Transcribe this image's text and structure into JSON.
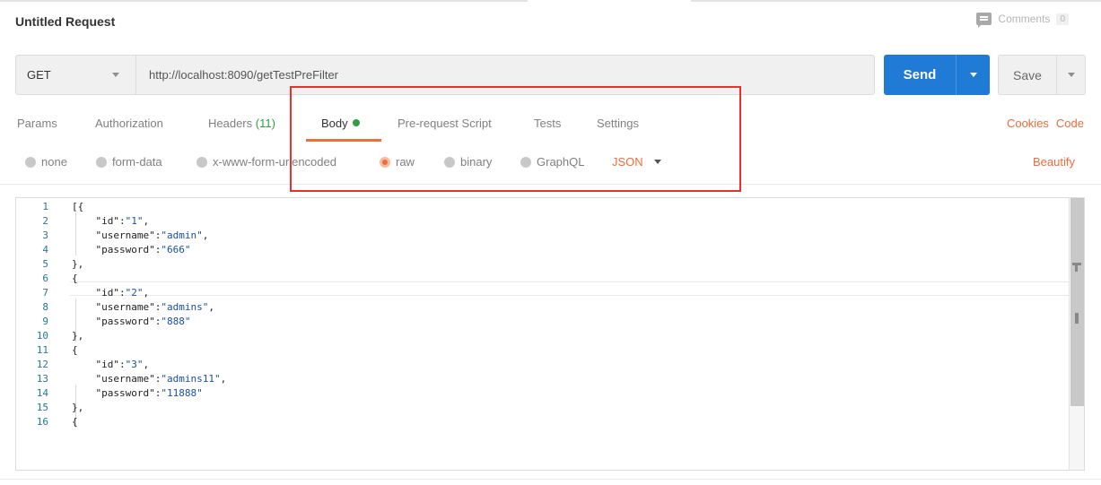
{
  "request": {
    "title": "Untitled Request",
    "comments_label": "Comments",
    "comments_count": "0",
    "method": "GET",
    "url": "http://localhost:8090/getTestPreFilter",
    "send_label": "Send",
    "save_label": "Save"
  },
  "tabs": {
    "params": "Params",
    "authorization": "Authorization",
    "headers": "Headers",
    "headers_count": "(11)",
    "body": "Body",
    "pre_request": "Pre-request Script",
    "tests": "Tests",
    "settings": "Settings",
    "active": "Body"
  },
  "links": {
    "cookies": "Cookies",
    "code": "Code"
  },
  "body_options": {
    "none": "none",
    "form_data": "form-data",
    "urlencoded": "x-www-form-urlencoded",
    "raw": "raw",
    "binary": "binary",
    "graphql": "GraphQL",
    "selected": "raw",
    "format": "JSON",
    "beautify": "Beautify"
  },
  "editor": {
    "lines": [
      {
        "n": "1",
        "text": "[{"
      },
      {
        "n": "2",
        "text": "    \"id\":\"1\","
      },
      {
        "n": "3",
        "text": "    \"username\":\"admin\","
      },
      {
        "n": "4",
        "text": "    \"password\":\"666\""
      },
      {
        "n": "5",
        "text": "},"
      },
      {
        "n": "6",
        "text": "{"
      },
      {
        "n": "7",
        "text": "    \"id\":\"2\","
      },
      {
        "n": "8",
        "text": "    \"username\":\"admins\","
      },
      {
        "n": "9",
        "text": "    \"password\":\"888\""
      },
      {
        "n": "10",
        "text": "},"
      },
      {
        "n": "11",
        "text": "{"
      },
      {
        "n": "12",
        "text": "    \"id\":\"3\","
      },
      {
        "n": "13",
        "text": "    \"username\":\"admins11\","
      },
      {
        "n": "14",
        "text": "    \"password\":\"11888\""
      },
      {
        "n": "15",
        "text": "},"
      },
      {
        "n": "16",
        "text": "{"
      }
    ]
  },
  "colors": {
    "accent": "#f26b3a",
    "send": "#1f7bd6",
    "highlight_box": "#e8302c",
    "status_dot": "#2fa040"
  }
}
